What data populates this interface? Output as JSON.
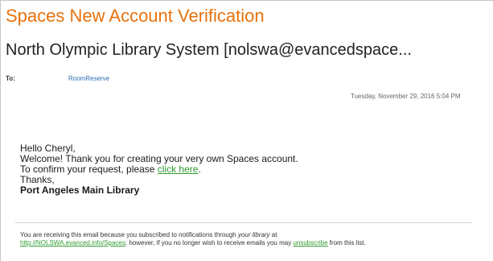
{
  "email": {
    "subject": "Spaces New Account Verification",
    "from": "North Olympic Library System [nolswa@evancedspace...",
    "to_label": "To:",
    "to_value": "RoomReserve",
    "date": "Tuesday, November 29, 2016 5:04 PM"
  },
  "body": {
    "greeting": "Hello Cheryl,",
    "welcome": "Welcome! Thank you for creating your very own Spaces account.",
    "confirm_prefix": "To confirm your request, please ",
    "confirm_link": "click here",
    "confirm_suffix": ".",
    "thanks": "Thanks,",
    "signature": "Port Angeles Main Library"
  },
  "footer": {
    "text_1": "You are receiving this email because you subscribed to notifications through ",
    "text_1_em": "your library",
    "text_1_end": " at",
    "url_link": "http://NOLSWA.evanced.info/Spaces",
    "text_2": "; however, if you no longer wish to receive emails you may ",
    "unsubscribe_link": "unsubscribe",
    "text_3": " from this list."
  },
  "colors": {
    "subject": "#e8720c",
    "link_green": "#2e9b2e",
    "recipient_blue": "#2a6db5"
  }
}
